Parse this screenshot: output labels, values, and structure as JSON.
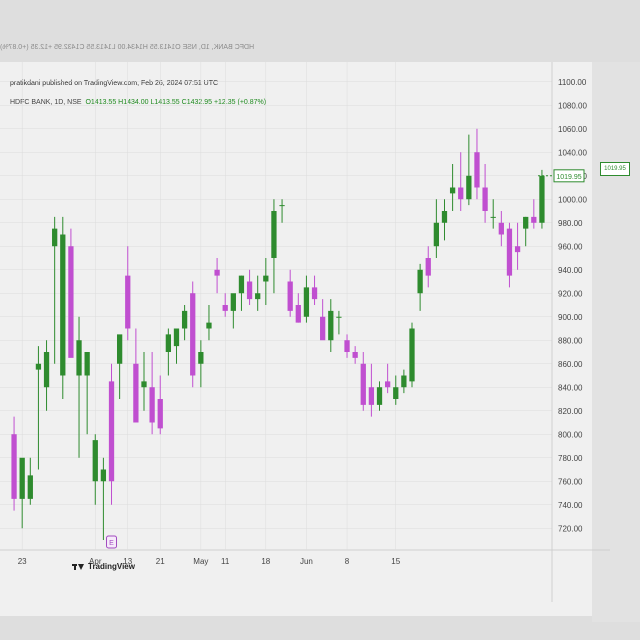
{
  "header": {
    "author_line": "pratikdani published on TradingView.com, Feb 26, 2024 07:51 UTC",
    "symbol": "HDFC BANK, 1D, NSE",
    "open": "O1413.55",
    "high": "H1434.00",
    "low": "L1413.55",
    "close": "C1432.95",
    "change": "+12.35 (+0.87%)"
  },
  "brand": {
    "name": "TradingView",
    "logo": "tradingview-logo-icon"
  },
  "colors": {
    "up": "#2e8b2e",
    "down": "#c04fd0",
    "grid": "#dcdcdc",
    "bg": "#f0f0f0"
  },
  "chart_data": {
    "type": "candlestick",
    "yticks": [
      "1100.00",
      "1080.00",
      "1060.00",
      "1040.00",
      "1020.00",
      "1000.00",
      "980.00",
      "960.00",
      "940.00",
      "920.00",
      "900.00",
      "880.00",
      "860.00",
      "840.00",
      "820.00",
      "800.00",
      "780.00",
      "760.00",
      "740.00",
      "720.00"
    ],
    "xticks": [
      "23",
      "Apr",
      "13",
      "21",
      "May",
      "11",
      "18",
      "Jun",
      "8",
      "15"
    ],
    "last_price_label": "1019.95",
    "ylim": [
      710,
      1110
    ],
    "grid": true,
    "event_marker": "E",
    "candles": [
      {
        "o": 800,
        "h": 815,
        "l": 735,
        "c": 745
      },
      {
        "o": 745,
        "h": 765,
        "l": 720,
        "c": 780
      },
      {
        "o": 745,
        "h": 780,
        "l": 740,
        "c": 765
      },
      {
        "o": 855,
        "h": 875,
        "l": 770,
        "c": 860
      },
      {
        "o": 840,
        "h": 880,
        "l": 820,
        "c": 870
      },
      {
        "o": 960,
        "h": 985,
        "l": 860,
        "c": 975
      },
      {
        "o": 850,
        "h": 985,
        "l": 830,
        "c": 970
      },
      {
        "o": 960,
        "h": 975,
        "l": 880,
        "c": 865
      },
      {
        "o": 850,
        "h": 900,
        "l": 780,
        "c": 880
      },
      {
        "o": 850,
        "h": 865,
        "l": 800,
        "c": 870
      },
      {
        "o": 760,
        "h": 800,
        "l": 740,
        "c": 795
      },
      {
        "o": 760,
        "h": 780,
        "l": 710,
        "c": 770
      },
      {
        "o": 845,
        "h": 860,
        "l": 740,
        "c": 760
      },
      {
        "o": 860,
        "h": 880,
        "l": 830,
        "c": 885
      },
      {
        "o": 935,
        "h": 960,
        "l": 880,
        "c": 890
      },
      {
        "o": 860,
        "h": 890,
        "l": 840,
        "c": 810
      },
      {
        "o": 840,
        "h": 870,
        "l": 820,
        "c": 845
      },
      {
        "o": 840,
        "h": 870,
        "l": 800,
        "c": 810
      },
      {
        "o": 830,
        "h": 850,
        "l": 800,
        "c": 805
      },
      {
        "o": 870,
        "h": 890,
        "l": 850,
        "c": 885
      },
      {
        "o": 875,
        "h": 890,
        "l": 860,
        "c": 890
      },
      {
        "o": 890,
        "h": 910,
        "l": 880,
        "c": 905
      },
      {
        "o": 920,
        "h": 930,
        "l": 840,
        "c": 850
      },
      {
        "o": 860,
        "h": 880,
        "l": 840,
        "c": 870
      },
      {
        "o": 890,
        "h": 910,
        "l": 880,
        "c": 895
      },
      {
        "o": 940,
        "h": 950,
        "l": 920,
        "c": 935
      },
      {
        "o": 910,
        "h": 920,
        "l": 900,
        "c": 905
      },
      {
        "o": 905,
        "h": 915,
        "l": 890,
        "c": 920
      },
      {
        "o": 920,
        "h": 935,
        "l": 905,
        "c": 935
      },
      {
        "o": 930,
        "h": 940,
        "l": 910,
        "c": 915
      },
      {
        "o": 915,
        "h": 935,
        "l": 905,
        "c": 920
      },
      {
        "o": 930,
        "h": 950,
        "l": 910,
        "c": 935
      },
      {
        "o": 950,
        "h": 1000,
        "l": 920,
        "c": 990
      },
      {
        "o": 995,
        "h": 1000,
        "l": 980,
        "c": 995
      },
      {
        "o": 930,
        "h": 940,
        "l": 900,
        "c": 905
      },
      {
        "o": 910,
        "h": 920,
        "l": 895,
        "c": 895
      },
      {
        "o": 900,
        "h": 935,
        "l": 895,
        "c": 925
      },
      {
        "o": 925,
        "h": 935,
        "l": 910,
        "c": 915
      },
      {
        "o": 900,
        "h": 915,
        "l": 890,
        "c": 880
      },
      {
        "o": 880,
        "h": 915,
        "l": 870,
        "c": 905
      },
      {
        "o": 900,
        "h": 905,
        "l": 885,
        "c": 900
      },
      {
        "o": 880,
        "h": 885,
        "l": 865,
        "c": 870
      },
      {
        "o": 870,
        "h": 875,
        "l": 860,
        "c": 865
      },
      {
        "o": 860,
        "h": 870,
        "l": 820,
        "c": 825
      },
      {
        "o": 840,
        "h": 860,
        "l": 815,
        "c": 825
      },
      {
        "o": 825,
        "h": 845,
        "l": 820,
        "c": 840
      },
      {
        "o": 845,
        "h": 860,
        "l": 835,
        "c": 840
      },
      {
        "o": 830,
        "h": 850,
        "l": 825,
        "c": 840
      },
      {
        "o": 840,
        "h": 855,
        "l": 835,
        "c": 850
      },
      {
        "o": 845,
        "h": 895,
        "l": 840,
        "c": 890
      },
      {
        "o": 920,
        "h": 945,
        "l": 905,
        "c": 940
      },
      {
        "o": 950,
        "h": 960,
        "l": 925,
        "c": 935
      },
      {
        "o": 960,
        "h": 1000,
        "l": 950,
        "c": 980
      },
      {
        "o": 980,
        "h": 1000,
        "l": 965,
        "c": 990
      },
      {
        "o": 1005,
        "h": 1030,
        "l": 990,
        "c": 1010
      },
      {
        "o": 1010,
        "h": 1040,
        "l": 990,
        "c": 1000
      },
      {
        "o": 1000,
        "h": 1055,
        "l": 995,
        "c": 1020
      },
      {
        "o": 1040,
        "h": 1060,
        "l": 1000,
        "c": 1010
      },
      {
        "o": 1010,
        "h": 1030,
        "l": 980,
        "c": 990
      },
      {
        "o": 985,
        "h": 1000,
        "l": 975,
        "c": 985
      },
      {
        "o": 980,
        "h": 990,
        "l": 960,
        "c": 970
      },
      {
        "o": 975,
        "h": 980,
        "l": 925,
        "c": 935
      },
      {
        "o": 960,
        "h": 980,
        "l": 940,
        "c": 955
      },
      {
        "o": 975,
        "h": 985,
        "l": 960,
        "c": 985
      },
      {
        "o": 985,
        "h": 1000,
        "l": 975,
        "c": 980
      },
      {
        "o": 980,
        "h": 1025,
        "l": 975,
        "c": 1020
      }
    ]
  }
}
